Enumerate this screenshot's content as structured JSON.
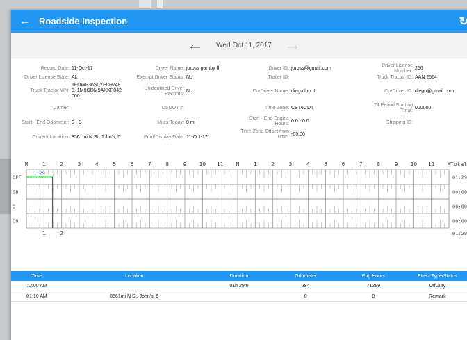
{
  "appbar": {
    "back_icon": "arrow-left-icon",
    "title": "Roadside Inspection",
    "refresh_icon": "refresh-icon"
  },
  "datebar": {
    "date": "Wed Oct 11, 2017"
  },
  "info": {
    "record_date": {
      "label": "Record Date:",
      "value": "11-Oct-17"
    },
    "driver_license_state": {
      "label": "Driver License State:",
      "value": "AL"
    },
    "truck_tractor_vin": {
      "label": "Truck Tractor VIN:",
      "value_lines": [
        "1FDWF36S0YED9248",
        "8, 1M8GDM9AXKP042",
        "000"
      ]
    },
    "carrier": {
      "label": "Carrier:",
      "value": ""
    },
    "start_end_odometer": {
      "label": "Start - End Odometer:",
      "value": "0 - 0"
    },
    "current_location": {
      "label": "Current Location:",
      "value": "8561mi N St. John's, 5"
    },
    "driver_name": {
      "label": "Driver Name:",
      "value": "joross gamby II"
    },
    "exempt_driver_status": {
      "label": "Exempt Driver Status:",
      "value": "No"
    },
    "unidentified_driver_records": {
      "label_lines": [
        "Unidentified Driver",
        "Records:"
      ],
      "value": "No"
    },
    "usdot": {
      "label": "USDOT #:",
      "value": ""
    },
    "miles_today": {
      "label": "Miles Today:",
      "value": "0 mi"
    },
    "print_display_date": {
      "label": "Print/Display Date:",
      "value": "11-Oct-17"
    },
    "driver_id": {
      "label": "Driver ID:",
      "value": "joross@gmail.com"
    },
    "trailer_id": {
      "label": "Trailer ID:",
      "value": ""
    },
    "co_driver_name": {
      "label": "Co-Driver Name:",
      "value": "diego luo II"
    },
    "time_zone": {
      "label": "Time Zone:",
      "value": "CST6CDT"
    },
    "start_end_engine_hours": {
      "label_lines": [
        "Start - End Engine",
        "Hours:"
      ],
      "value": "0.0 - 0.0"
    },
    "time_zone_offset": {
      "label_lines": [
        "Time Zone Offset from",
        "UTC:"
      ],
      "value": "-05:00"
    },
    "driver_license_number": {
      "label_lines": [
        "Driver License",
        "Number:"
      ],
      "value": "256"
    },
    "truck_tractor_id": {
      "label": "Truck Tractor ID:",
      "value": "AAN 2564"
    },
    "co_driver_id": {
      "label": "Co-Driver ID:",
      "value": "diego@gmail.com"
    },
    "period_starting_time": {
      "label_lines": [
        "24 Period Starting",
        "Time:"
      ],
      "value": "000000"
    },
    "shipping_id": {
      "label": "Shipping ID:",
      "value": ""
    }
  },
  "chart_data": {
    "type": "table",
    "hour_labels": [
      "M",
      "1",
      "2",
      "3",
      "4",
      "5",
      "6",
      "7",
      "8",
      "9",
      "10",
      "11",
      "N",
      "1",
      "2",
      "3",
      "4",
      "5",
      "6",
      "7",
      "8",
      "9",
      "10",
      "11",
      "M"
    ],
    "rows": [
      "OFF",
      "SB",
      "D",
      "ON"
    ],
    "totals_header": "Total",
    "totals": [
      "01:29",
      "00:00",
      "00:00",
      "00:00"
    ],
    "grand_total": "01:29",
    "duty_segments": [
      {
        "status": "OFF",
        "start_hour": 0,
        "end_hour": 1.483,
        "label": "1:29"
      }
    ],
    "bottom_markers": [
      "1",
      "2"
    ],
    "line_color": "#2ecc40"
  },
  "events": {
    "headers": [
      "Time",
      "Location",
      "Duration",
      "Odometer",
      "Eng Hours",
      "Event Type/Status"
    ],
    "rows": [
      {
        "time": "12:00 AM",
        "location": "",
        "duration": "01h 29m",
        "odometer": "284",
        "eng_hours": "71289",
        "status": "OffDuty"
      },
      {
        "time": "01:10 AM",
        "location": "8561mi N St. John's, 5",
        "duration": "",
        "odometer": "0",
        "eng_hours": "0",
        "status": "Remark"
      }
    ]
  },
  "colors": {
    "primary": "#2196f3",
    "header_bg": "#f2f2f2"
  }
}
